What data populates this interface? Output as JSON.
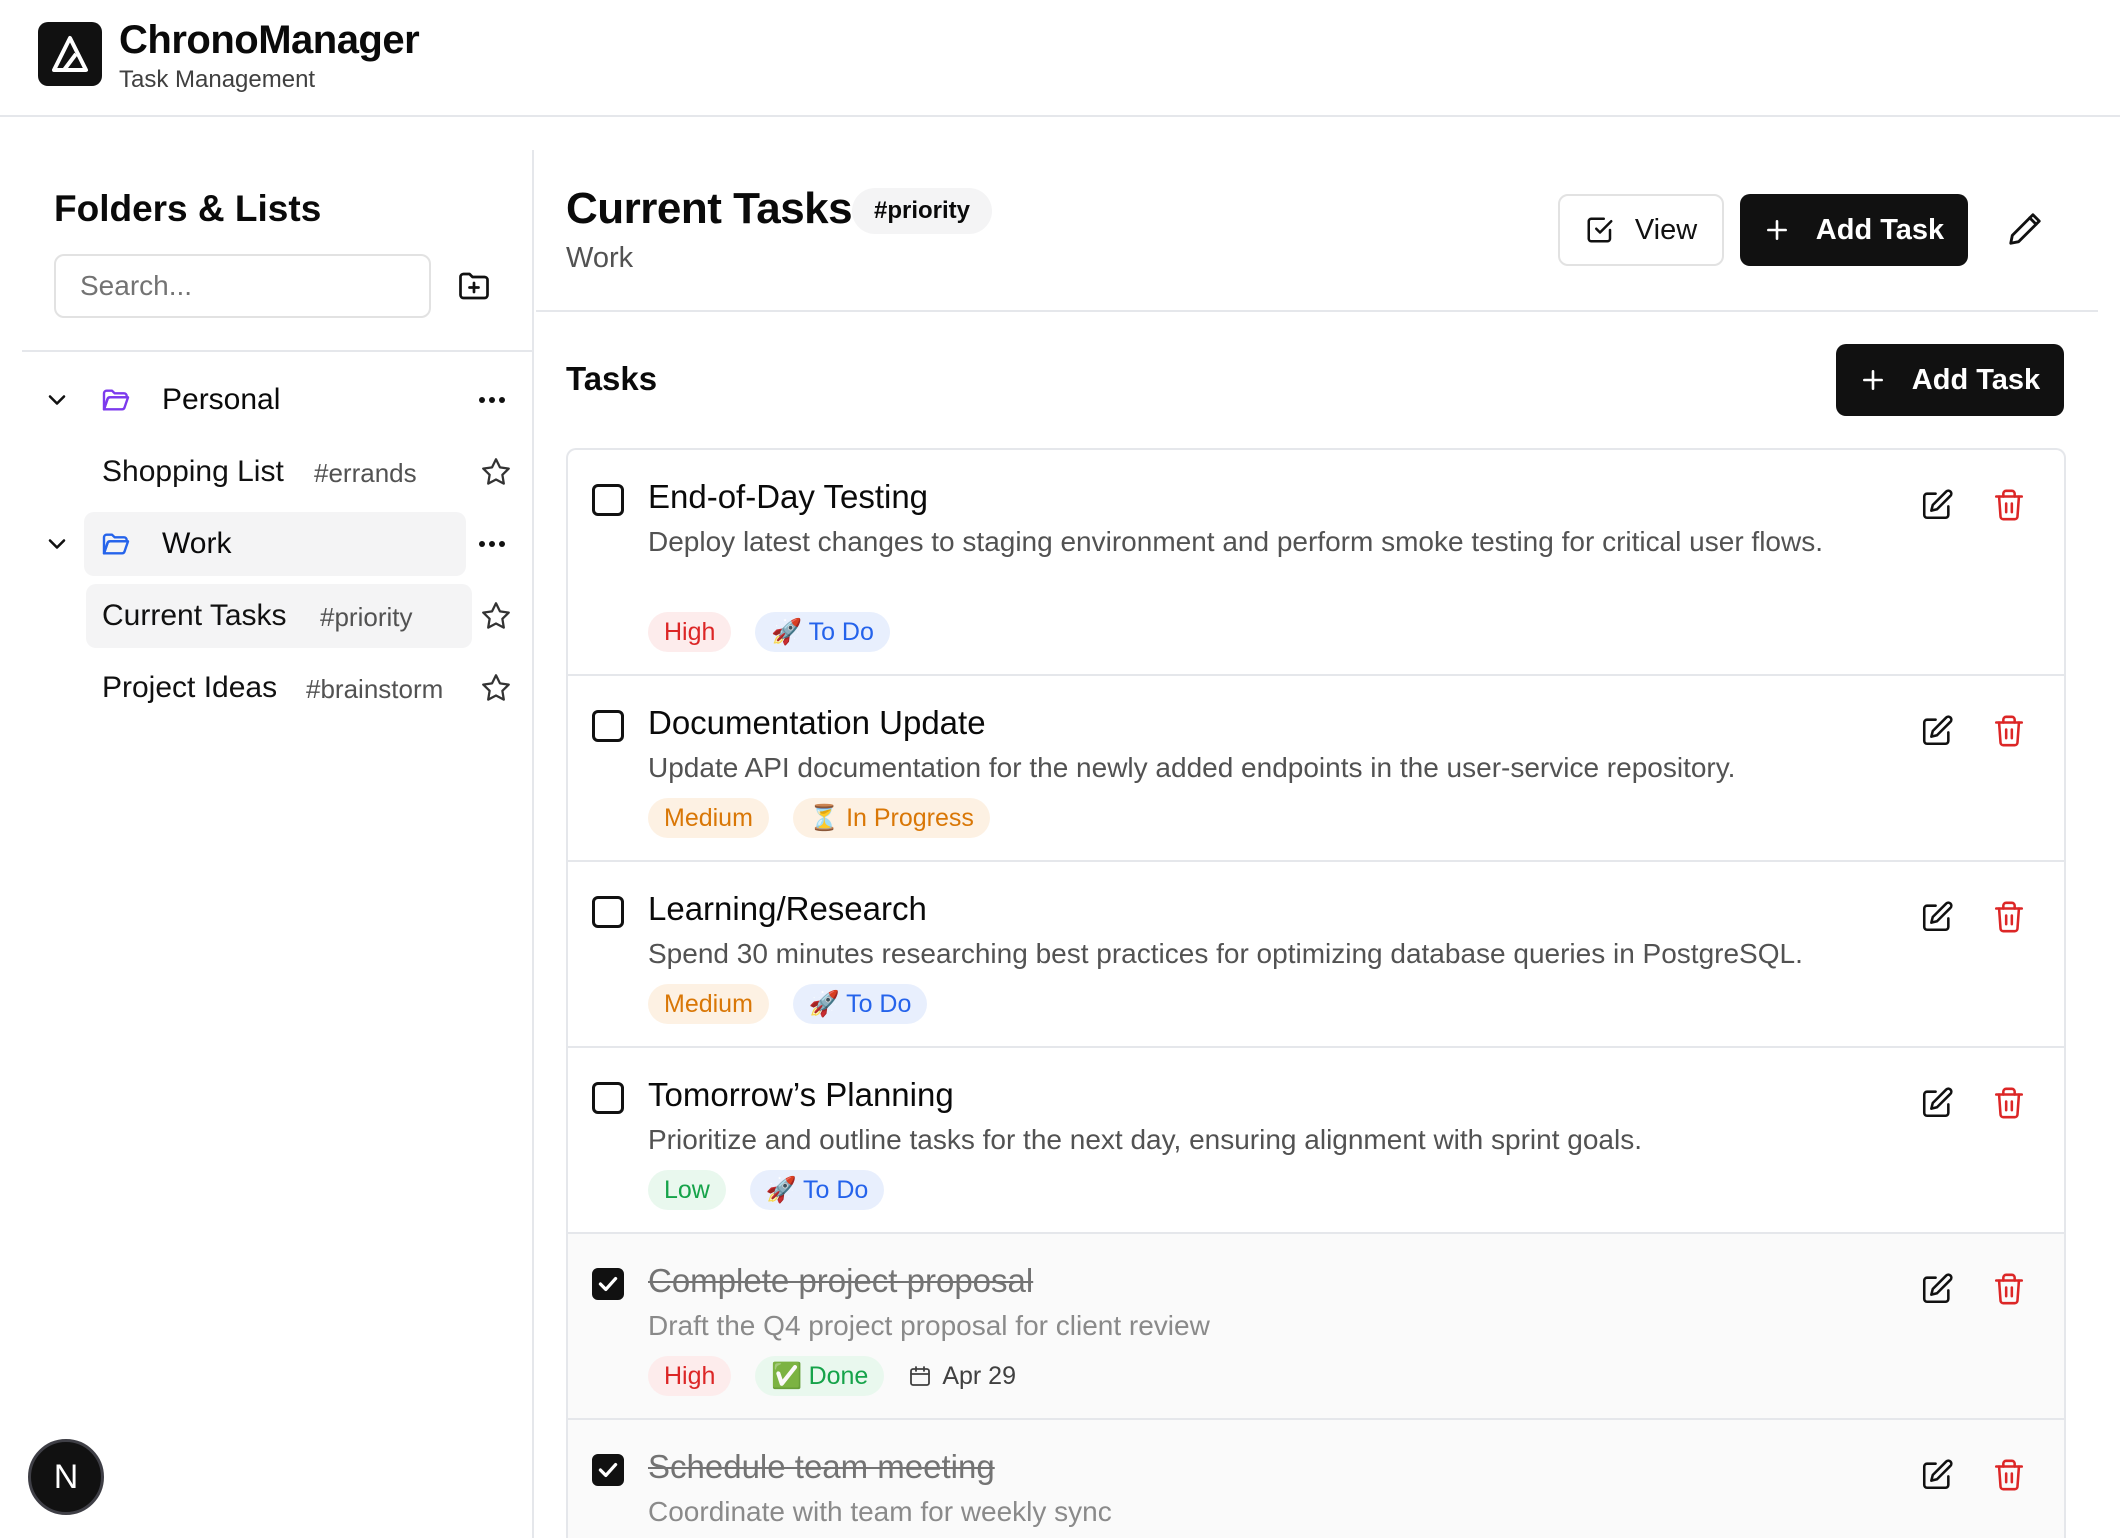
{
  "app": {
    "title": "ChronoManager",
    "subtitle": "Task Management"
  },
  "sidebar": {
    "title": "Folders & Lists",
    "search_placeholder": "Search...",
    "folders": [
      {
        "label": "Personal",
        "icon": "folder-open-icon",
        "color": "#7c3aed",
        "expanded": true,
        "lists": [
          {
            "label": "Shopping List",
            "tag": "#errands"
          }
        ]
      },
      {
        "label": "Work",
        "icon": "folder-open-icon",
        "color": "#2563eb",
        "expanded": true,
        "active": true,
        "lists": [
          {
            "label": "Current Tasks",
            "tag": "#priority",
            "active": true
          },
          {
            "label": "Project Ideas",
            "tag": "#brainstorm"
          }
        ]
      }
    ]
  },
  "main": {
    "title": "Current Tasks",
    "tag": "#priority",
    "folder": "Work",
    "view_button": "View",
    "add_task_button": "Add Task",
    "tasks_heading": "Tasks",
    "tasks_add_button": "Add Task"
  },
  "tasks": [
    {
      "title": "End-of-Day Testing",
      "description": "Deploy latest changes to staging environment and perform smoke testing for critical user flows.",
      "priority": "High",
      "status": "To Do",
      "status_icon": "🚀",
      "completed": false
    },
    {
      "title": "Documentation Update",
      "description": "Update API documentation for the newly added endpoints in the user-service repository.",
      "priority": "Medium",
      "status": "In Progress",
      "status_icon": "⏳",
      "completed": false
    },
    {
      "title": "Learning/Research",
      "description": "Spend 30 minutes researching best practices for optimizing database queries in PostgreSQL.",
      "priority": "Medium",
      "status": "To Do",
      "status_icon": "🚀",
      "completed": false
    },
    {
      "title": "Tomorrow’s Planning",
      "description": "Prioritize and outline tasks for the next day, ensuring alignment with sprint goals.",
      "priority": "Low",
      "status": "To Do",
      "status_icon": "🚀",
      "completed": false
    },
    {
      "title": "Complete project proposal",
      "description": "Draft the Q4 project proposal for client review",
      "priority": "High",
      "status": "Done",
      "status_icon": "✅",
      "due": "Apr 29",
      "completed": true
    },
    {
      "title": "Schedule team meeting",
      "description": "Coordinate with team for weekly sync",
      "completed": true
    }
  ],
  "dev_badge": "N",
  "colors": {
    "accent": "#111111",
    "high": "#dc2626",
    "medium": "#d97706",
    "low": "#16a34a",
    "todo": "#2563eb",
    "delete": "#dc2626"
  }
}
